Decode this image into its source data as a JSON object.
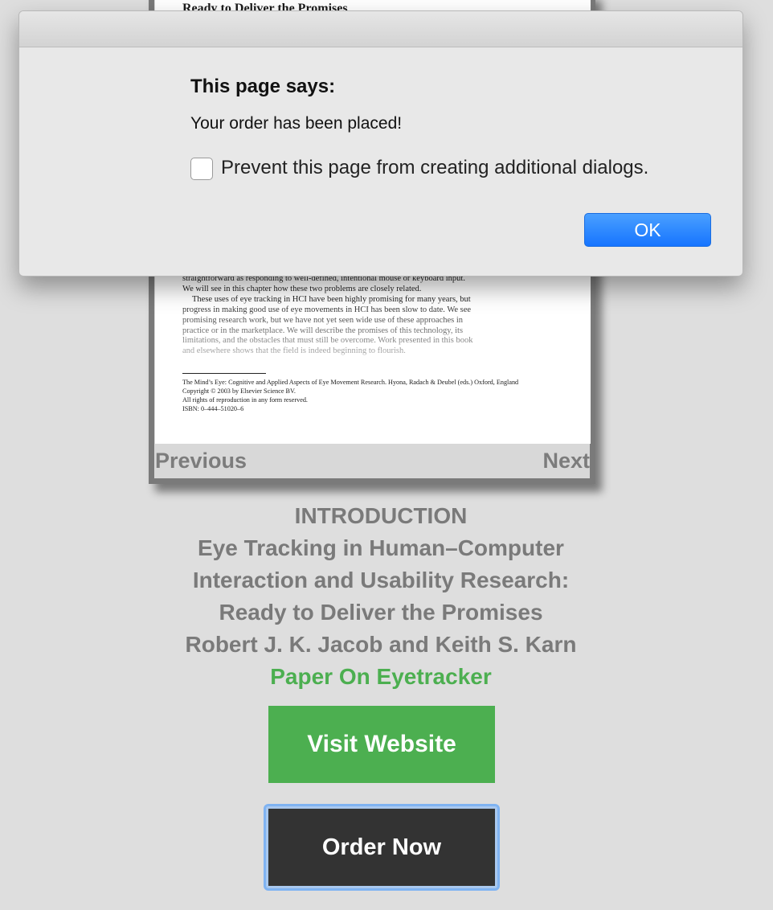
{
  "book_page": {
    "running_title": "Ready to Deliver the Promises",
    "paragraph_lines": [
      "straightforward as responding to well-defined, intentional mouse or keyboard input.",
      "We will see in this chapter how these two problems are closely related.",
      "These uses of eye tracking in HCI have been highly promising for many years, but",
      "progress in making good use of eye movements in HCI has been slow to date. We see",
      "promising research work, but we have not yet seen wide use of these approaches in",
      "practice or in the marketplace. We will describe the promises of this technology, its",
      "limitations, and the obstacles that must still be overcome. Work presented in this book",
      "and elsewhere shows that the field is indeed beginning to flourish."
    ],
    "footnote_lines": [
      "The Mind’s Eye: Cognitive and Applied Aspects of Eye Movement Research. Hyona, Radach & Deubel (eds.) Oxford, England",
      "Copyright © 2003 by Elsevier Science BV.",
      "All rights of reproduction in any form reserved.",
      "ISBN: 0–444–51020–6"
    ]
  },
  "viewer_nav": {
    "previous_label": "Previous",
    "next_label": "Next"
  },
  "book_info": {
    "section": "INTRODUCTION",
    "title_lines": [
      "Eye Tracking in Human–Computer",
      "Interaction and Usability Research:",
      "Ready to Deliver the Promises"
    ],
    "authors": "Robert J. K. Jacob and Keith S. Karn",
    "category": "Paper On Eyetracker",
    "category_color": "#4caf50"
  },
  "actions": {
    "visit_label": "Visit Website",
    "order_label": "Order Now"
  },
  "dialog": {
    "heading": "This page says:",
    "message": "Your order has been placed!",
    "checkbox_label": "Prevent this page from creating additional dialogs.",
    "checkbox_checked": false,
    "ok_label": "OK"
  }
}
